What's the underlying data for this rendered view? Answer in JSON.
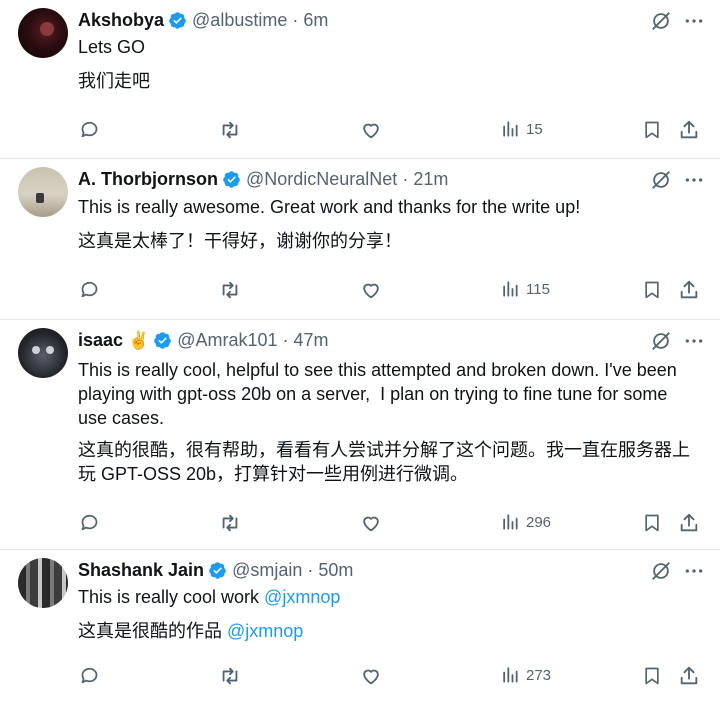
{
  "tweets": [
    {
      "name": "Akshobya",
      "handle": "@albustime",
      "time": "6m",
      "text_en": "Lets GO",
      "text_zh": "我们走吧",
      "views": "15",
      "verified": true
    },
    {
      "name": "A. Thorbjornson",
      "handle": "@NordicNeuralNet",
      "time": "21m",
      "text_en": "This is really awesome. Great work and thanks for the write up!",
      "text_zh": "这真是太棒了！干得好，谢谢你的分享！",
      "views": "115",
      "verified": true
    },
    {
      "name": "isaac",
      "name_emoji": "✌️",
      "handle": "@Amrak101",
      "time": "47m",
      "text_en_lines": [
        "This is really cool, helpful to see this attempted and broken down. I've been",
        "playing with gpt-oss 20b on a server,  I plan on trying to fine tune for some",
        "use cases."
      ],
      "text_zh_lines": [
        "这真的很酷，很有帮助，看看有人尝试并分解了这个问题。我一直在服务器上",
        "玩 GPT-OSS 20b，打算针对一些用例进行微调。"
      ],
      "views": "296",
      "verified": true
    },
    {
      "name": "Shashank Jain",
      "handle": "@smjain",
      "time": "50m",
      "text_en": "This is really cool work ",
      "text_en_mention": "@jxmnop",
      "text_zh": "这真是很酷的作品 ",
      "text_zh_mention": "@jxmnop",
      "views": "273",
      "verified": true
    }
  ],
  "separator": " · ",
  "icons": {
    "reply": "reply-icon",
    "repost": "repost-icon",
    "like": "like-icon",
    "views": "views-icon",
    "bookmark": "bookmark-icon",
    "share": "share-icon",
    "grok": "grok-icon",
    "more": "more-icon",
    "verified": "verified-badge-icon"
  },
  "colors": {
    "text": "#0f1419",
    "secondary": "#536471",
    "accent": "#1d9bf0",
    "divider": "#e6e9eb"
  }
}
